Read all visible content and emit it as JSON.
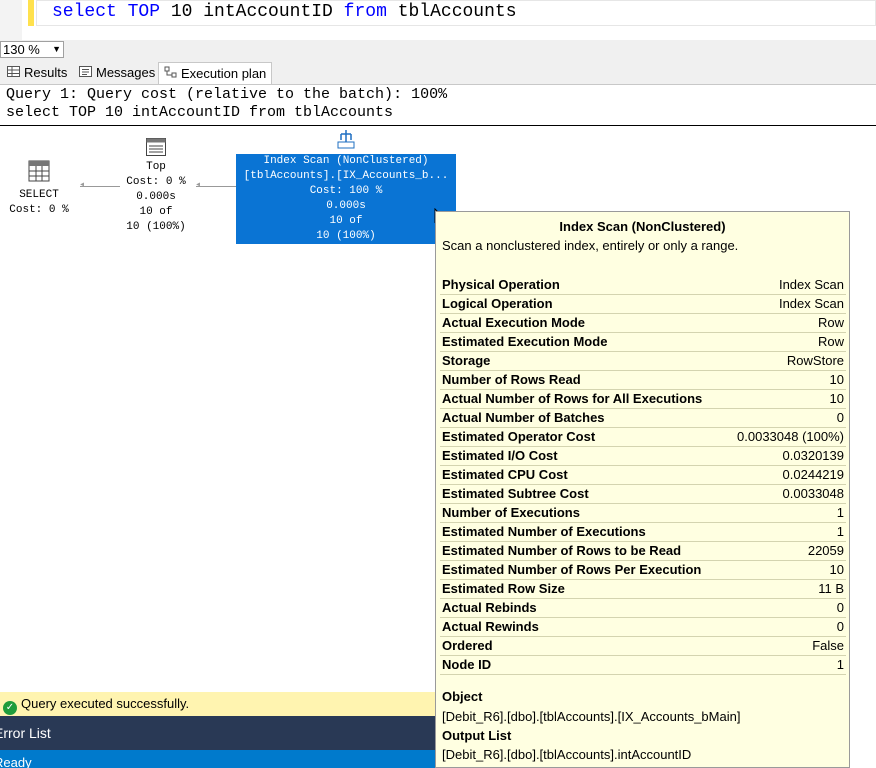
{
  "editor": {
    "keyword_select": "select",
    "keyword_top": "TOP",
    "mid_text": " 10 intAccountID ",
    "keyword_from": "from",
    "table": " tblAccounts"
  },
  "zoom": {
    "value": "130 %"
  },
  "tabs": [
    {
      "label": "Results"
    },
    {
      "label": "Messages"
    },
    {
      "label": "Execution plan"
    }
  ],
  "plan": {
    "header_line1": "Query 1: Query cost (relative to the batch): 100%",
    "header_line2": "select TOP 10 intAccountID from tblAccounts",
    "select_node": {
      "label": "SELECT",
      "cost": "Cost: 0 %"
    },
    "top_node": {
      "label": "Top",
      "cost": "Cost: 0 %",
      "time": "0.000s",
      "rows": "10 of",
      "pct": "10 (100%)"
    },
    "scan_node": {
      "label": "Index Scan (NonClustered)",
      "object": "[tblAccounts].[IX_Accounts_b...",
      "cost": "Cost: 100 %",
      "time": "0.000s",
      "rows": "10 of",
      "pct": "10 (100%)"
    }
  },
  "tooltip": {
    "title": "Index Scan (NonClustered)",
    "description": "Scan a nonclustered index, entirely or only a range.",
    "rows": [
      [
        "Physical Operation",
        "Index Scan"
      ],
      [
        "Logical Operation",
        "Index Scan"
      ],
      [
        "Actual Execution Mode",
        "Row"
      ],
      [
        "Estimated Execution Mode",
        "Row"
      ],
      [
        "Storage",
        "RowStore"
      ],
      [
        "Number of Rows Read",
        "10"
      ],
      [
        "Actual Number of Rows for All Executions",
        "10"
      ],
      [
        "Actual Number of Batches",
        "0"
      ],
      [
        "Estimated Operator Cost",
        "0.0033048 (100%)"
      ],
      [
        "Estimated I/O Cost",
        "0.0320139"
      ],
      [
        "Estimated CPU Cost",
        "0.0244219"
      ],
      [
        "Estimated Subtree Cost",
        "0.0033048"
      ],
      [
        "Number of Executions",
        "1"
      ],
      [
        "Estimated Number of Executions",
        "1"
      ],
      [
        "Estimated Number of Rows to be Read",
        "22059"
      ],
      [
        "Estimated Number of Rows Per Execution",
        "10"
      ],
      [
        "Estimated Row Size",
        "11 B"
      ],
      [
        "Actual Rebinds",
        "0"
      ],
      [
        "Actual Rewinds",
        "0"
      ],
      [
        "Ordered",
        "False"
      ],
      [
        "Node ID",
        "1"
      ]
    ],
    "object_label": "Object",
    "object_value": "[Debit_R6].[dbo].[tblAccounts].[IX_Accounts_bMain]",
    "output_label": "Output List",
    "output_value": "[Debit_R6].[dbo].[tblAccounts].intAccountID"
  },
  "status": {
    "message": "Query executed successfully.",
    "error_list": "Error List",
    "ready": "Ready"
  }
}
